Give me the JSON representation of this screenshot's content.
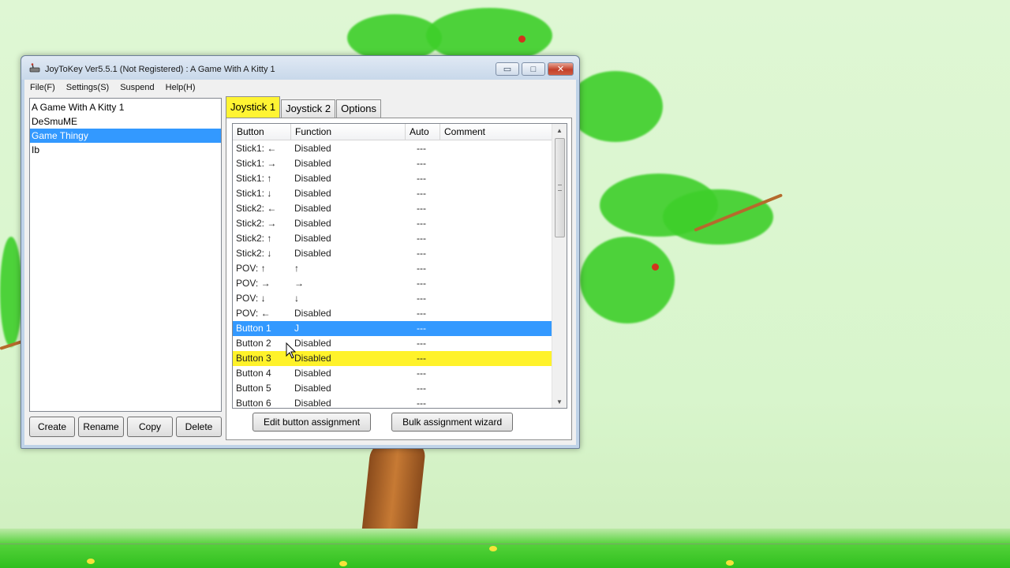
{
  "window": {
    "title": "JoyToKey Ver5.5.1 (Not Registered) : A Game With A Kitty 1",
    "minimize_glyph": "▭",
    "maximize_glyph": "□",
    "close_glyph": "✕"
  },
  "menu": {
    "items": [
      "File(F)",
      "Settings(S)",
      "Suspend",
      "Help(H)"
    ]
  },
  "profiles": {
    "items": [
      {
        "label": "A Game With A Kitty 1",
        "selected": false
      },
      {
        "label": "DeSmuME",
        "selected": false
      },
      {
        "label": "Game Thingy",
        "selected": true
      },
      {
        "label": "Ib",
        "selected": false
      }
    ],
    "buttons": {
      "create": "Create",
      "rename": "Rename",
      "copy": "Copy",
      "delete": "Delete"
    }
  },
  "tabs": [
    {
      "label": "Joystick 1",
      "active": true
    },
    {
      "label": "Joystick 2",
      "active": false
    },
    {
      "label": "Options",
      "active": false
    }
  ],
  "table": {
    "headers": {
      "button": "Button",
      "function": "Function",
      "auto": "Auto",
      "comment": "Comment"
    },
    "rows": [
      {
        "button": "Stick1: ←",
        "function": "Disabled",
        "auto": "---",
        "comment": "",
        "state": ""
      },
      {
        "button": "Stick1: →",
        "function": "Disabled",
        "auto": "---",
        "comment": "",
        "state": ""
      },
      {
        "button": "Stick1: ↑",
        "function": "Disabled",
        "auto": "---",
        "comment": "",
        "state": ""
      },
      {
        "button": "Stick1: ↓",
        "function": "Disabled",
        "auto": "---",
        "comment": "",
        "state": ""
      },
      {
        "button": "Stick2: ←",
        "function": "Disabled",
        "auto": "---",
        "comment": "",
        "state": ""
      },
      {
        "button": "Stick2: →",
        "function": "Disabled",
        "auto": "---",
        "comment": "",
        "state": ""
      },
      {
        "button": "Stick2: ↑",
        "function": "Disabled",
        "auto": "---",
        "comment": "",
        "state": ""
      },
      {
        "button": "Stick2: ↓",
        "function": "Disabled",
        "auto": "---",
        "comment": "",
        "state": ""
      },
      {
        "button": "POV: ↑",
        "function": "↑",
        "auto": "---",
        "comment": "",
        "state": ""
      },
      {
        "button": "POV: →",
        "function": "→",
        "auto": "---",
        "comment": "",
        "state": ""
      },
      {
        "button": "POV: ↓",
        "function": "↓",
        "auto": "---",
        "comment": "",
        "state": ""
      },
      {
        "button": "POV: ←",
        "function": "Disabled",
        "auto": "---",
        "comment": "",
        "state": ""
      },
      {
        "button": "Button 1",
        "function": "J",
        "auto": "---",
        "comment": "",
        "state": "selected"
      },
      {
        "button": "Button 2",
        "function": "Disabled",
        "auto": "---",
        "comment": "",
        "state": ""
      },
      {
        "button": "Button 3",
        "function": "Disabled",
        "auto": "---",
        "comment": "",
        "state": "highlight"
      },
      {
        "button": "Button 4",
        "function": "Disabled",
        "auto": "---",
        "comment": "",
        "state": ""
      },
      {
        "button": "Button 5",
        "function": "Disabled",
        "auto": "---",
        "comment": "",
        "state": ""
      },
      {
        "button": "Button 6",
        "function": "Disabled",
        "auto": "---",
        "comment": "",
        "state": ""
      }
    ]
  },
  "actions": {
    "edit": "Edit button assignment",
    "bulk": "Bulk assignment wizard"
  },
  "scroll": {
    "up_glyph": "▲",
    "down_glyph": "▼"
  },
  "colors": {
    "selection": "#3399ff",
    "highlight": "#fff22a",
    "active_tab": "#fff433"
  }
}
